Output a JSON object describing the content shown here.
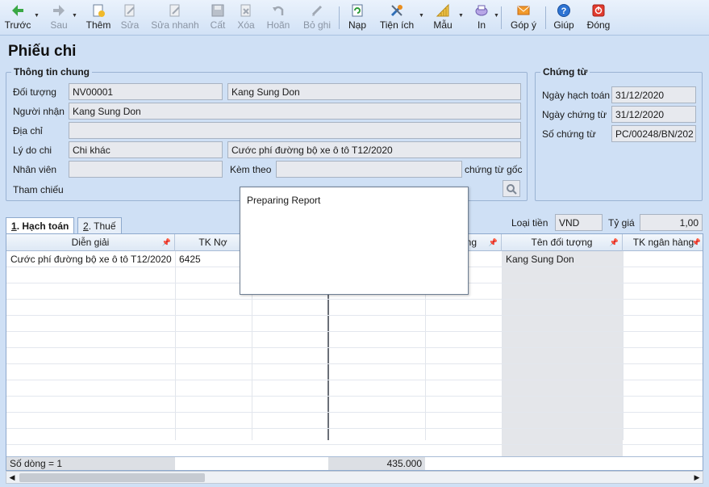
{
  "toolbar": {
    "items": [
      {
        "label": "Trước",
        "icon": "arrow-left-icon"
      },
      {
        "label": "Sau",
        "icon": "arrow-right-icon"
      },
      {
        "label": "Thêm",
        "icon": "add-document-icon"
      },
      {
        "label": "Sửa",
        "icon": "edit-icon"
      },
      {
        "label": "Sửa nhanh",
        "icon": "quick-edit-icon"
      },
      {
        "label": "Cất",
        "icon": "save-icon"
      },
      {
        "label": "Xóa",
        "icon": "delete-icon"
      },
      {
        "label": "Hoãn",
        "icon": "undo-icon"
      },
      {
        "label": "Bỏ ghi",
        "icon": "unpost-icon"
      },
      {
        "label": "Nạp",
        "icon": "refresh-icon"
      },
      {
        "label": "Tiện ích",
        "icon": "tools-icon"
      },
      {
        "label": "Mẫu",
        "icon": "template-icon"
      },
      {
        "label": "In",
        "icon": "print-icon"
      },
      {
        "label": "Góp ý",
        "icon": "feedback-mail-icon"
      },
      {
        "label": "Giúp",
        "icon": "help-icon"
      },
      {
        "label": "Đóng",
        "icon": "close-icon"
      }
    ]
  },
  "page_title": "Phiếu chi",
  "general": {
    "title": "Thông tin chung",
    "doi_tuong_label": "Đối tượng",
    "doi_tuong_code": "NV00001",
    "doi_tuong_name": "Kang Sung Don",
    "nguoi_nhan_label": "Người nhận",
    "nguoi_nhan": "Kang Sung Don",
    "dia_chi_label": "Địa chỉ",
    "dia_chi": "",
    "ly_do_label": "Lý do chi",
    "ly_do_code": "Chi khác",
    "ly_do_text": "Cước phí đường bộ xe ô tô T12/2020",
    "nhan_vien_label": "Nhân viên",
    "nhan_vien": "",
    "kem_theo_label": "Kèm theo",
    "kem_theo": "",
    "chung_tu_goc_label": "chứng từ gốc",
    "tham_chieu_label": "Tham chiếu"
  },
  "voucher": {
    "title": "Chứng từ",
    "ngay_hach_toan_label": "Ngày hạch toán",
    "ngay_hach_toan": "31/12/2020",
    "ngay_chung_tu_label": "Ngày chứng từ",
    "ngay_chung_tu": "31/12/2020",
    "so_chung_tu_label": "Số chứng từ",
    "so_chung_tu": "PC/00248/BN/202"
  },
  "tabs": [
    {
      "key": "1",
      "label": ". Hạch toán"
    },
    {
      "key": "2",
      "label": ". Thuế"
    }
  ],
  "currency": {
    "loai_tien_label": "Loại tiền",
    "loai_tien": "VND",
    "ty_gia_label": "Tỷ giá",
    "ty_gia": "1,00"
  },
  "grid": {
    "columns": [
      "Diễn giải",
      "TK Nợ",
      "",
      "",
      "ng",
      "Tên đối tượng",
      "TK ngân hàng"
    ],
    "rows": [
      {
        "dien_giai": "Cước phí đường bộ xe ô tô T12/2020",
        "tk_no": "6425",
        "ten_doi_tuong": "Kang Sung Don"
      }
    ],
    "footer_count": "Số dòng = 1",
    "footer_total": "435.000"
  },
  "popup": {
    "text": "Preparing Report"
  }
}
